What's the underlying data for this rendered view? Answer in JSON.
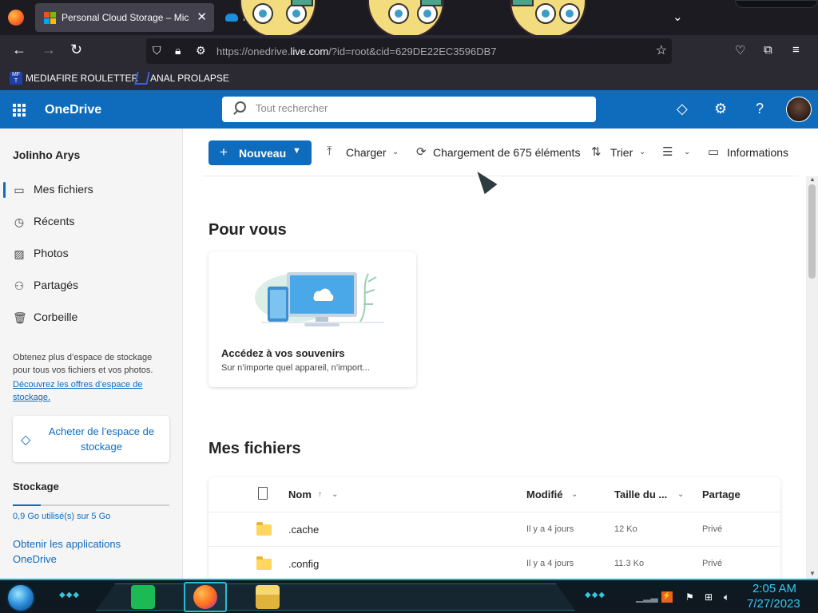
{
  "browser": {
    "active_tab_title": "Personal Cloud Storage – Micro",
    "second_tab_title": "M",
    "url_prefix": "https://onedrive.",
    "url_domain": "live.com",
    "url_rest": "/?id=root&cid=629DE22EC3596DB7",
    "bookmarks": [
      {
        "label": "MEDIAFIRE ROULETTER",
        "icon": "mediafire-icon"
      },
      {
        "label": "ANAL PROLAPSE",
        "icon": "bookmark-icon"
      }
    ],
    "bookmark_icon_text": "MF\nT"
  },
  "onedrive": {
    "app_name": "OneDrive",
    "search_placeholder": "Tout rechercher",
    "accent": "#0f6cbd"
  },
  "sidebar": {
    "user_name": "Jolinho Arys",
    "items": [
      {
        "label": "Mes fichiers",
        "icon": "folder-icon",
        "active": true
      },
      {
        "label": "Récents",
        "icon": "history-icon",
        "active": false
      },
      {
        "label": "Photos",
        "icon": "image-icon",
        "active": false
      },
      {
        "label": "Partagés",
        "icon": "people-icon",
        "active": false
      },
      {
        "label": "Corbeille",
        "icon": "trash-icon",
        "active": false
      }
    ],
    "promo_text": "Obtenez plus d’espace de stockage pour tous vos fichiers et vos photos.",
    "promo_link": "Découvrez les offres d’espace de stockage.",
    "buy_storage_label": "Acheter de l’espace de stockage",
    "storage_title": "Stockage",
    "storage_used_text": "0,9 Go utilisé(s) sur 5 Go",
    "storage_used_fraction": 0.18,
    "get_apps_label": "Obtenir les applications OneDrive"
  },
  "toolbar": {
    "new_label": "Nouveau",
    "upload_label": "Charger",
    "status_label": "Chargement de 675 éléments",
    "sort_label": "Trier",
    "info_label": "Informations"
  },
  "main": {
    "for_you_title": "Pour vous",
    "card_title": "Accédez à vos souvenirs",
    "card_subtitle": "Sur n’importe quel appareil, n’import...",
    "my_files_title": "Mes fichiers",
    "columns": {
      "name": "Nom",
      "name_sort": "↑",
      "modified": "Modifié",
      "size": "Taille du ...",
      "sharing": "Partage"
    },
    "rows": [
      {
        "name": ".cache",
        "modified": "Il y a 4 jours",
        "size": "12 Ko",
        "sharing": "Privé"
      },
      {
        "name": ".config",
        "modified": "Il y a 4 jours",
        "size": "11.3 Ko",
        "sharing": "Privé"
      }
    ]
  },
  "taskbar": {
    "time": "2:05 AM",
    "date": "7/27/2023"
  }
}
